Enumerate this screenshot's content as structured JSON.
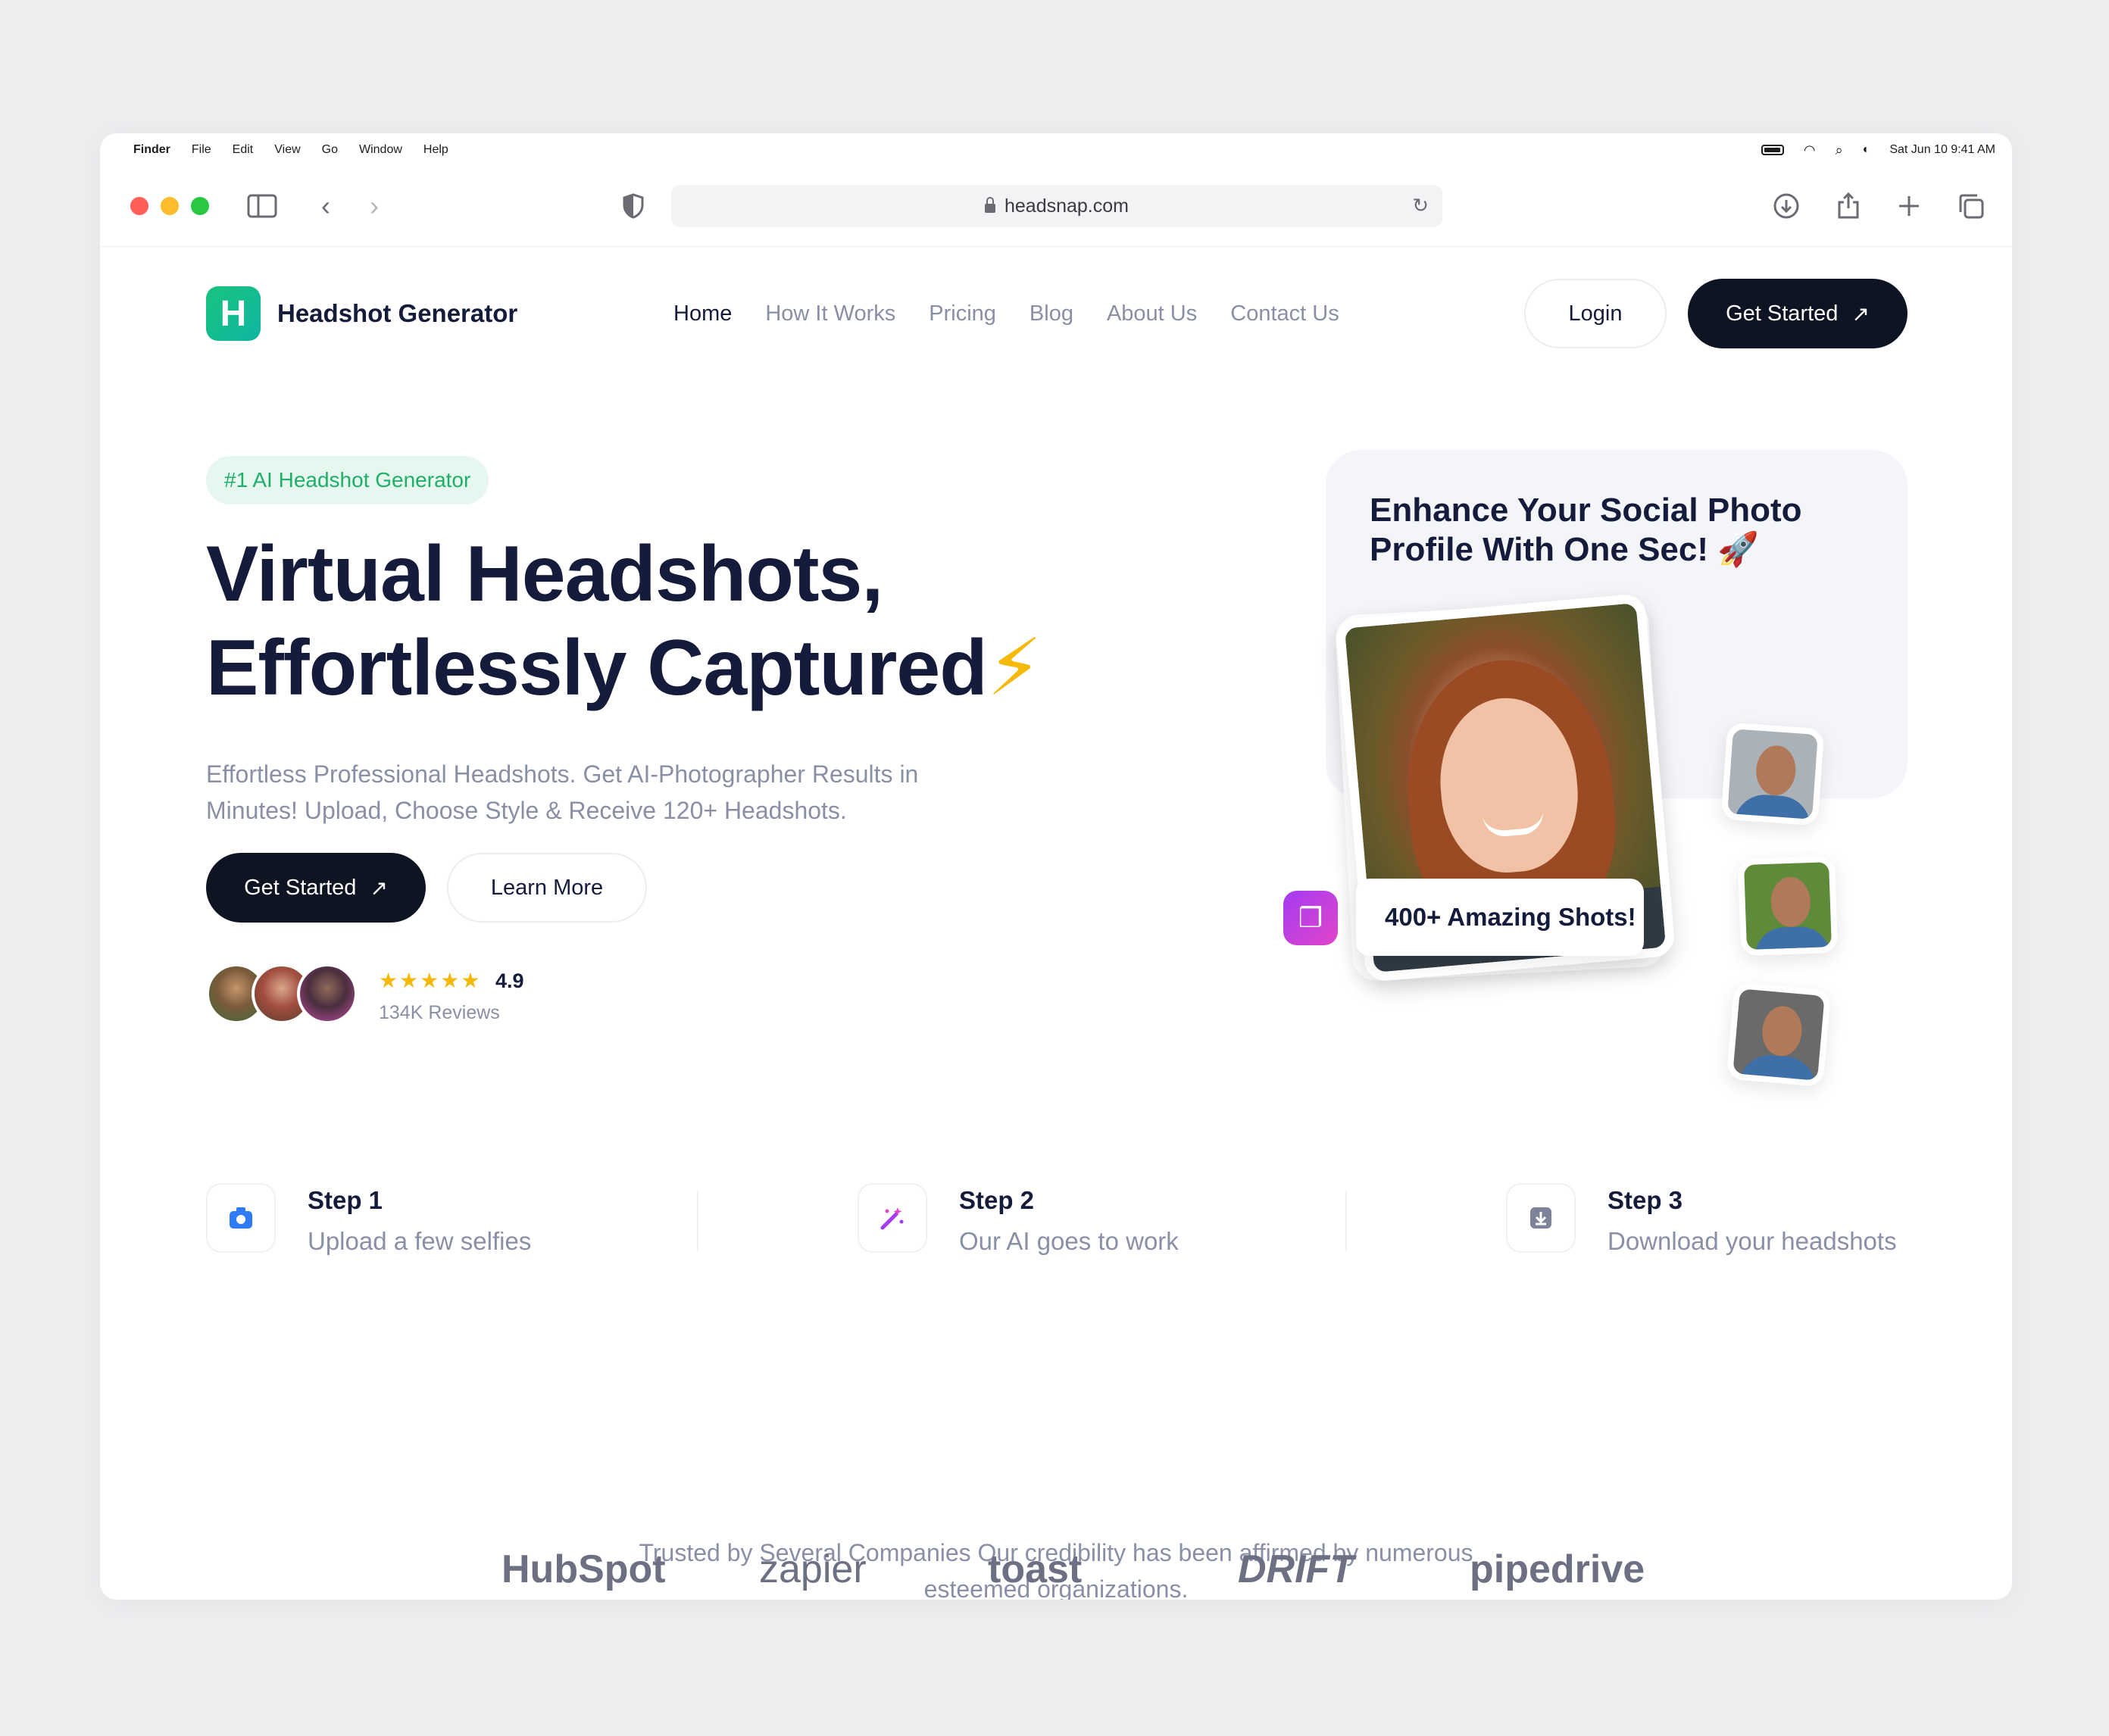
{
  "menubar": {
    "items": [
      "Finder",
      "File",
      "Edit",
      "View",
      "Go",
      "Window",
      "Help"
    ],
    "datetime": "Sat Jun 10  9:41 AM"
  },
  "browser": {
    "url": "headsnap.com"
  },
  "nav": {
    "brand": "Headshot Generator",
    "brand_letter": "H",
    "links": [
      "Home",
      "How It Works",
      "Pricing",
      "Blog",
      "About Us",
      "Contact Us"
    ],
    "active": "Home",
    "login": "Login",
    "get_started": "Get Started"
  },
  "hero": {
    "badge": "#1 AI Headshot Generator",
    "title_line1": "Virtual Headshots,",
    "title_line2": "Effortlessly Captured",
    "subtitle": "Effortless Professional Headshots. Get AI-Photographer Results in Minutes! Upload, Choose Style & Receive 120+ Headshots.",
    "cta_primary": "Get Started",
    "cta_secondary": "Learn More",
    "rating_value": "4.9",
    "rating_stars": 5,
    "reviews": "134K Reviews"
  },
  "card": {
    "title": "Enhance Your Social Photo Profile With One Sec! 🚀",
    "shots_label": "400+ Amazing Shots!"
  },
  "steps": [
    {
      "title": "Step 1",
      "desc": "Upload a few selfies",
      "icon": "camera-icon"
    },
    {
      "title": "Step 2",
      "desc": "Our AI goes to work",
      "icon": "magic-wand-icon"
    },
    {
      "title": "Step 3",
      "desc": "Download your headshots",
      "icon": "download-icon"
    }
  ],
  "trusted": {
    "text": "Trusted by Several Companies Our credibility has been affirmed by numerous esteemed organizations."
  },
  "brands": [
    "HubSpot",
    "zapier",
    "toast",
    "DRIFT",
    "pipedrive"
  ],
  "colors": {
    "accent_green": "#1FAF6A",
    "dark_button": "#0F1423",
    "text_dark": "#151B3B",
    "text_muted": "#8A8FA6",
    "star": "#F5B90B"
  }
}
